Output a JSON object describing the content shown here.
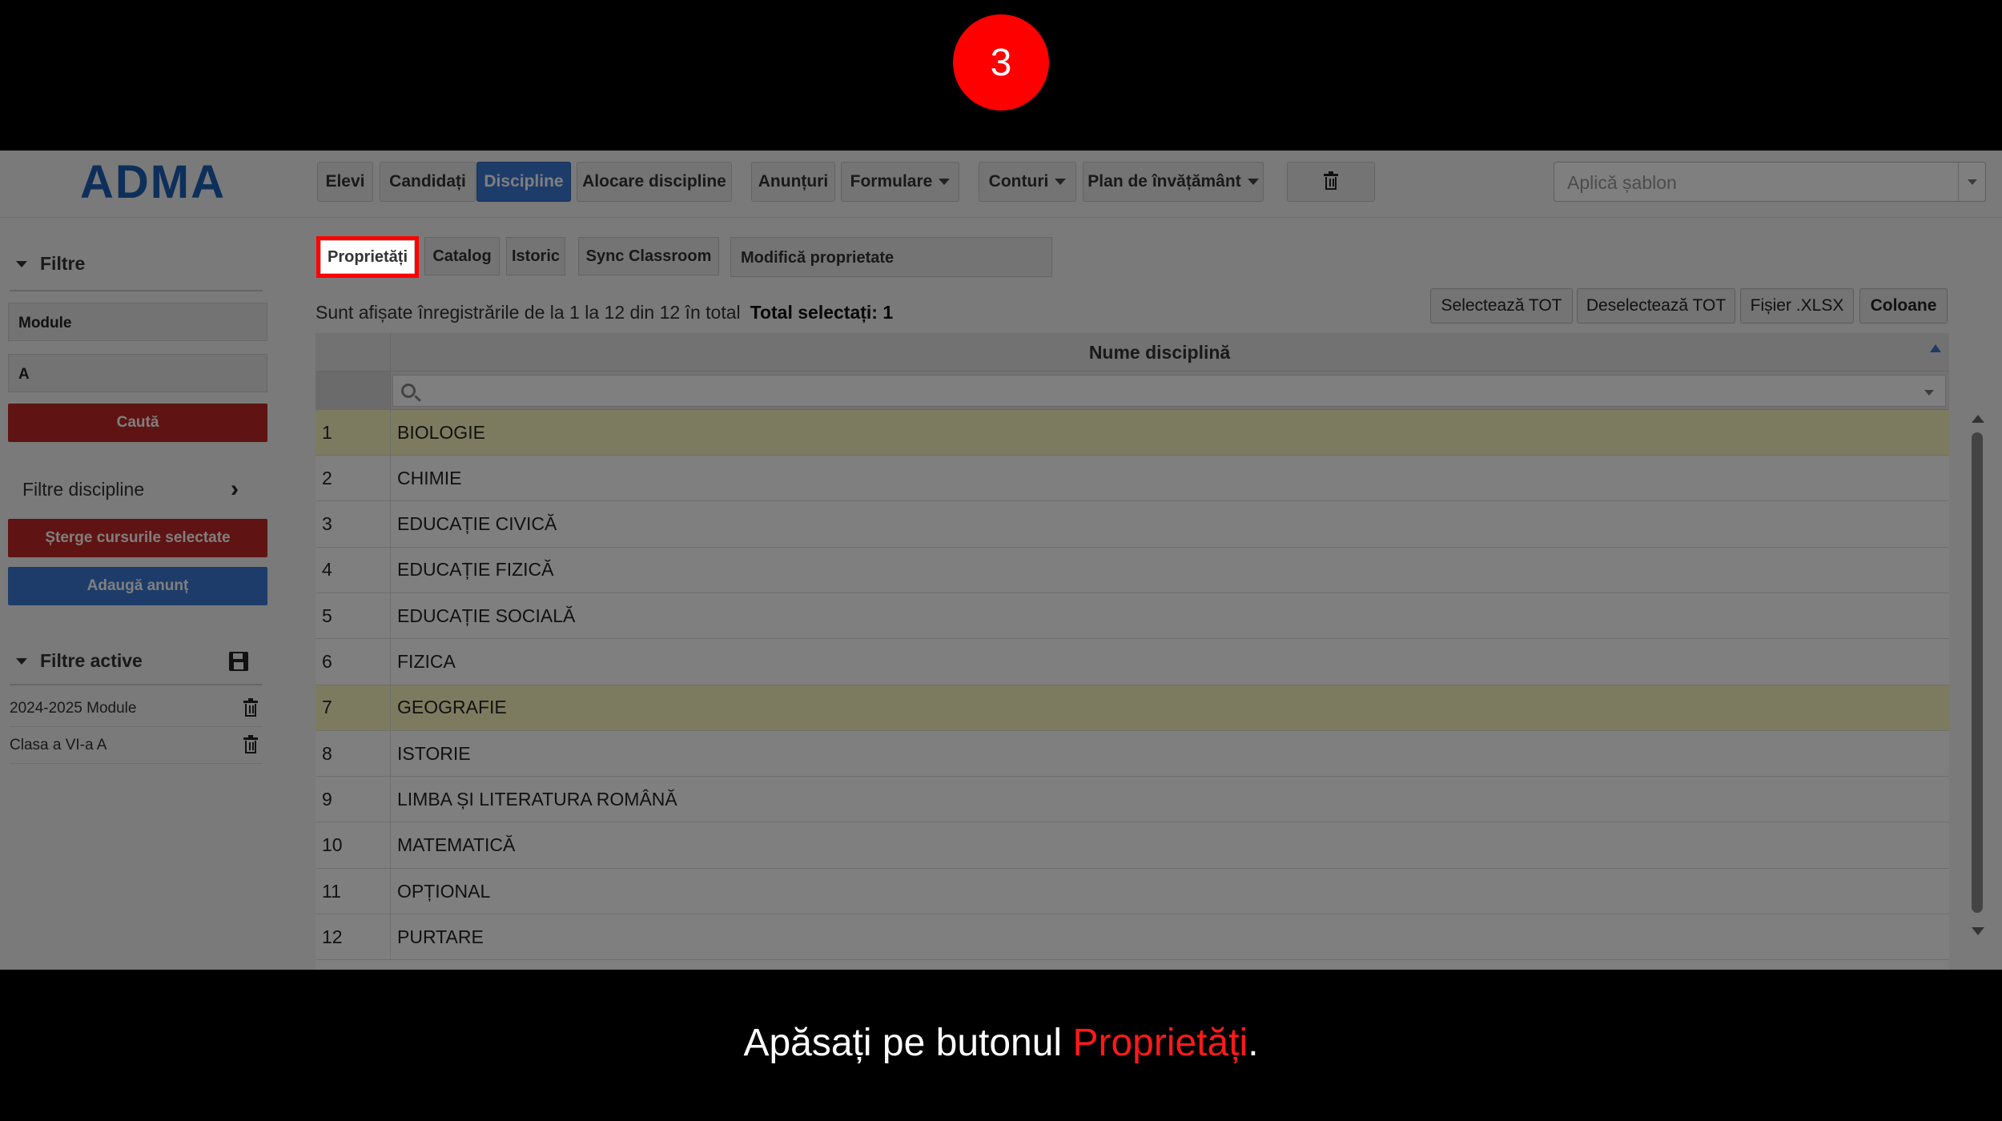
{
  "step_number": "3",
  "header": {
    "logo": "ADMA",
    "nav": {
      "elevi": "Elevi",
      "candidati": "Candidați",
      "discipline": "Discipline",
      "alocare": "Alocare discipline",
      "anunturi": "Anunțuri",
      "formulare": "Formulare",
      "conturi": "Conturi",
      "plan": "Plan de învățământ"
    },
    "template_placeholder": "Aplică șablon"
  },
  "sidebar": {
    "filters_title": "Filtre",
    "field_module": "Module",
    "field_a": "A",
    "search_label": "Caută",
    "filter_disciplines": "Filtre discipline",
    "delete_courses": "Șterge cursurile selectate",
    "add_announcement": "Adaugă anunț",
    "active_filters_title": "Filtre active",
    "active_filters": [
      "2024-2025 Module",
      "Clasa a VI-a A"
    ]
  },
  "subtabs": {
    "proprietati": "Proprietăți",
    "catalog": "Catalog",
    "istoric": "Istoric",
    "sync": "Sync Classroom",
    "modify_property": "Modifică proprietate"
  },
  "info": {
    "records_text": "Sunt afișate înregistrările de la 1 la 12 din 12 în total",
    "selected_text": "Total selectați: 1"
  },
  "actions": {
    "select_all": "Selectează TOT",
    "deselect_all": "Deselectează TOT",
    "xlsx": "Fișier .XLSX",
    "columns": "Coloane"
  },
  "table": {
    "column_header": "Nume disciplină",
    "rows": [
      {
        "n": "1",
        "name": "BIOLOGIE",
        "highlighted": true
      },
      {
        "n": "2",
        "name": "CHIMIE",
        "highlighted": false
      },
      {
        "n": "3",
        "name": "EDUCAȚIE CIVICĂ",
        "highlighted": false
      },
      {
        "n": "4",
        "name": "EDUCAȚIE FIZICĂ",
        "highlighted": false
      },
      {
        "n": "5",
        "name": "EDUCAȚIE SOCIALĂ",
        "highlighted": false
      },
      {
        "n": "6",
        "name": "FIZICA",
        "highlighted": false
      },
      {
        "n": "7",
        "name": "GEOGRAFIE",
        "highlighted": true
      },
      {
        "n": "8",
        "name": "ISTORIE",
        "highlighted": false
      },
      {
        "n": "9",
        "name": "LIMBA ȘI LITERATURA ROMÂNĂ",
        "highlighted": false
      },
      {
        "n": "10",
        "name": "MATEMATICĂ",
        "highlighted": false
      },
      {
        "n": "11",
        "name": "OPȚIONAL",
        "highlighted": false
      },
      {
        "n": "12",
        "name": "PURTARE",
        "highlighted": false
      }
    ]
  },
  "caption": {
    "prefix": "Apăsați pe butonul ",
    "highlight": "Proprietăți",
    "suffix": "."
  },
  "colors": {
    "accent_blue": "#3b79d3",
    "danger_red": "#c02626",
    "highlight_red": "#ff0000",
    "row_highlight": "#fbf7bf"
  }
}
